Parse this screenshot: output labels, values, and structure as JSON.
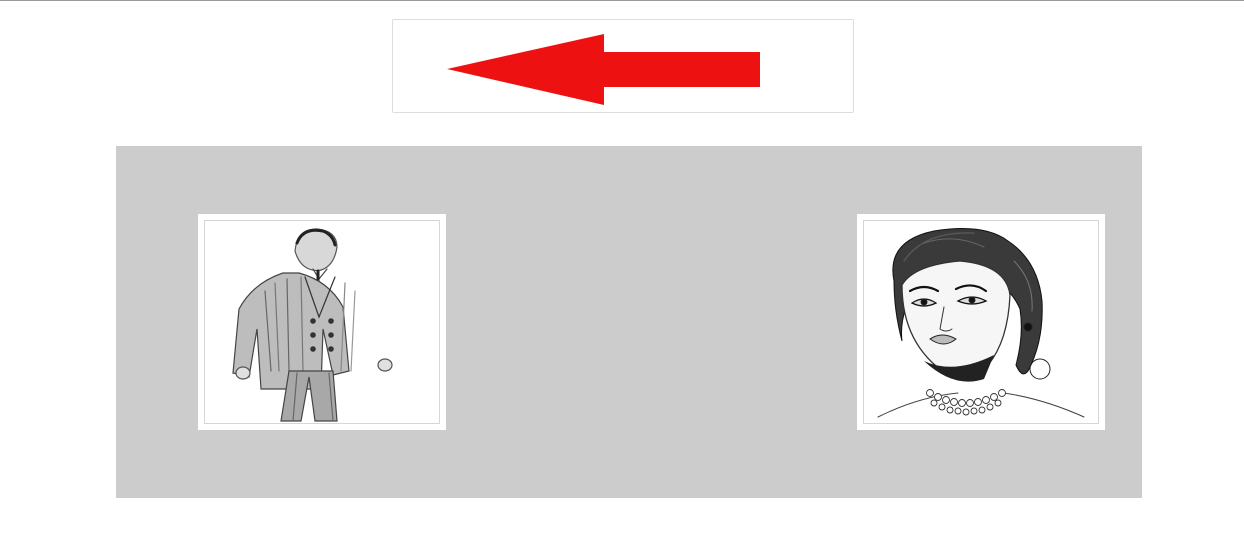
{
  "colors": {
    "arrow": "#ee1111",
    "stage_background": "#cccccc",
    "page_background": "#ffffff"
  },
  "arrow_button": {
    "icon": "left-arrow-icon",
    "direction": "left"
  },
  "images": [
    {
      "icon": "man-in-suit-sketch",
      "subject": "sketch"
    },
    {
      "icon": "woman-portrait-sketch",
      "subject": "sketch"
    }
  ]
}
